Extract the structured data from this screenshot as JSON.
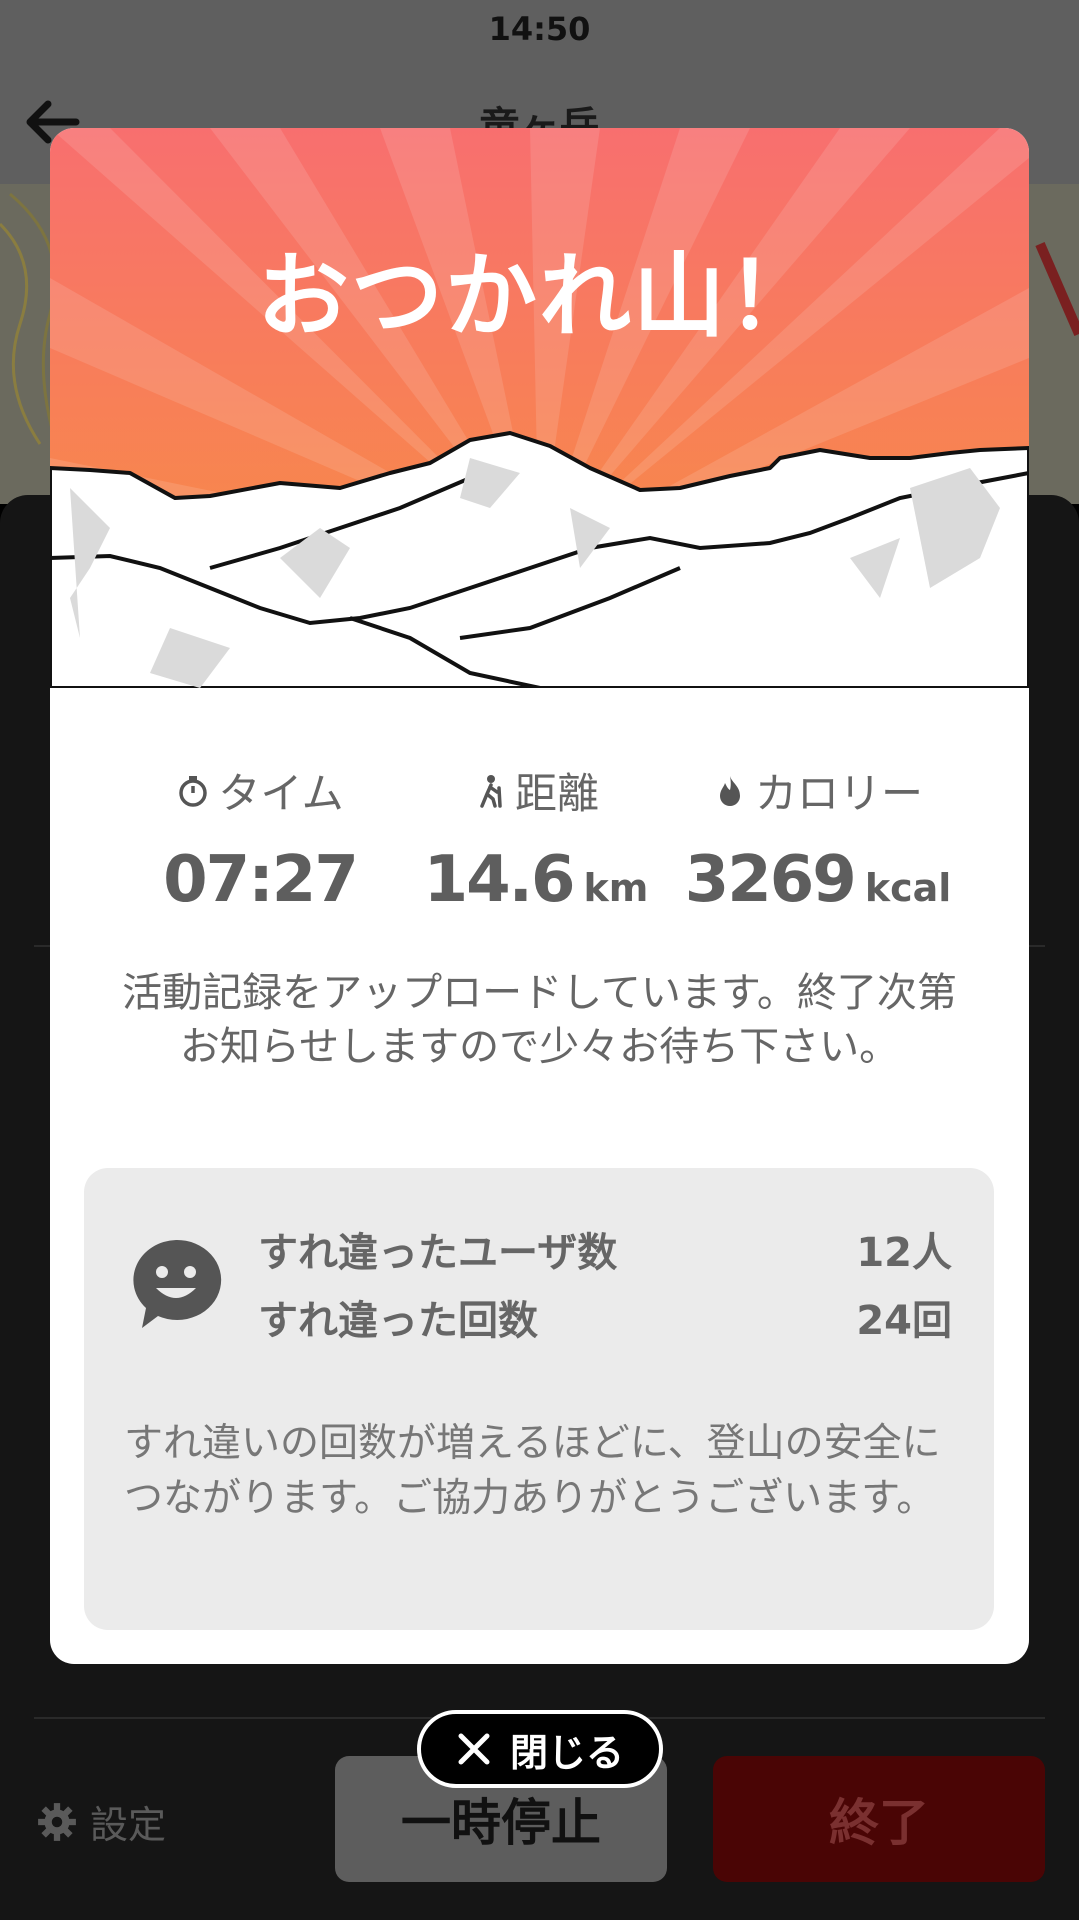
{
  "status_bar": {
    "time": "14:50"
  },
  "nav": {
    "title": "竜ヶ岳"
  },
  "modal": {
    "title": "おつかれ山！",
    "stats": [
      {
        "icon": "stopwatch-icon",
        "label": "タイム",
        "value": "07:27",
        "unit": ""
      },
      {
        "icon": "hiker-icon",
        "label": "距離",
        "value": "14.6",
        "unit": "km"
      },
      {
        "icon": "flame-icon",
        "label": "カロリー",
        "value": "3269",
        "unit": "kcal"
      }
    ],
    "upload_message": "活動記録をアップロードしています。終了次第お知らせしますので少々お待ち下さい。",
    "encounter": {
      "icon": "smiley-chat-icon",
      "rows": [
        {
          "label": "すれ違ったユーザ数",
          "value": "12人"
        },
        {
          "label": "すれ違った回数",
          "value": "24回"
        }
      ],
      "note": "すれ違いの回数が増えるほどに、登山の安全につながります。ご協力ありがとうございます。"
    }
  },
  "close_button": {
    "label": "閉じる"
  },
  "bottom_bar": {
    "settings_label": "設定",
    "pause_label": "一時停止",
    "end_label": "終了"
  },
  "colors": {
    "hero_top": "#f86f6f",
    "hero_bottom": "#f7913e",
    "end_button": "#4a0505"
  }
}
